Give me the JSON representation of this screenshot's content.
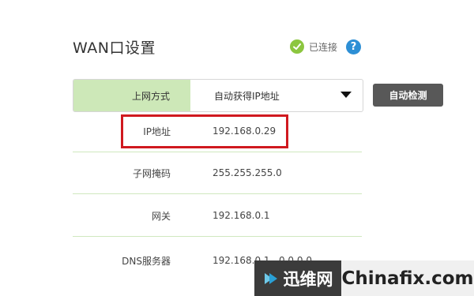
{
  "page": {
    "title": "WAN口设置"
  },
  "status": {
    "text": "已连接",
    "help_glyph": "?"
  },
  "connection": {
    "label": "上网方式",
    "selected": "自动获得IP地址",
    "detect_label": "自动检测"
  },
  "fields": [
    {
      "label": "IP地址",
      "value": "192.168.0.29"
    },
    {
      "label": "子网掩码",
      "value": "255.255.255.0"
    },
    {
      "label": "网关",
      "value": "192.168.0.1"
    },
    {
      "label": "DNS服务器",
      "value": "192.168.0.1 , 0.0.0.0"
    }
  ],
  "watermark": {
    "left_text": "迅维网",
    "right_text": "Chinafix.com"
  },
  "colors": {
    "accent_green": "#8cc63f",
    "label_bg": "#cde8b8",
    "help_blue": "#2d8fd5",
    "highlight_red": "#d0191f",
    "button_dark": "#585858"
  }
}
